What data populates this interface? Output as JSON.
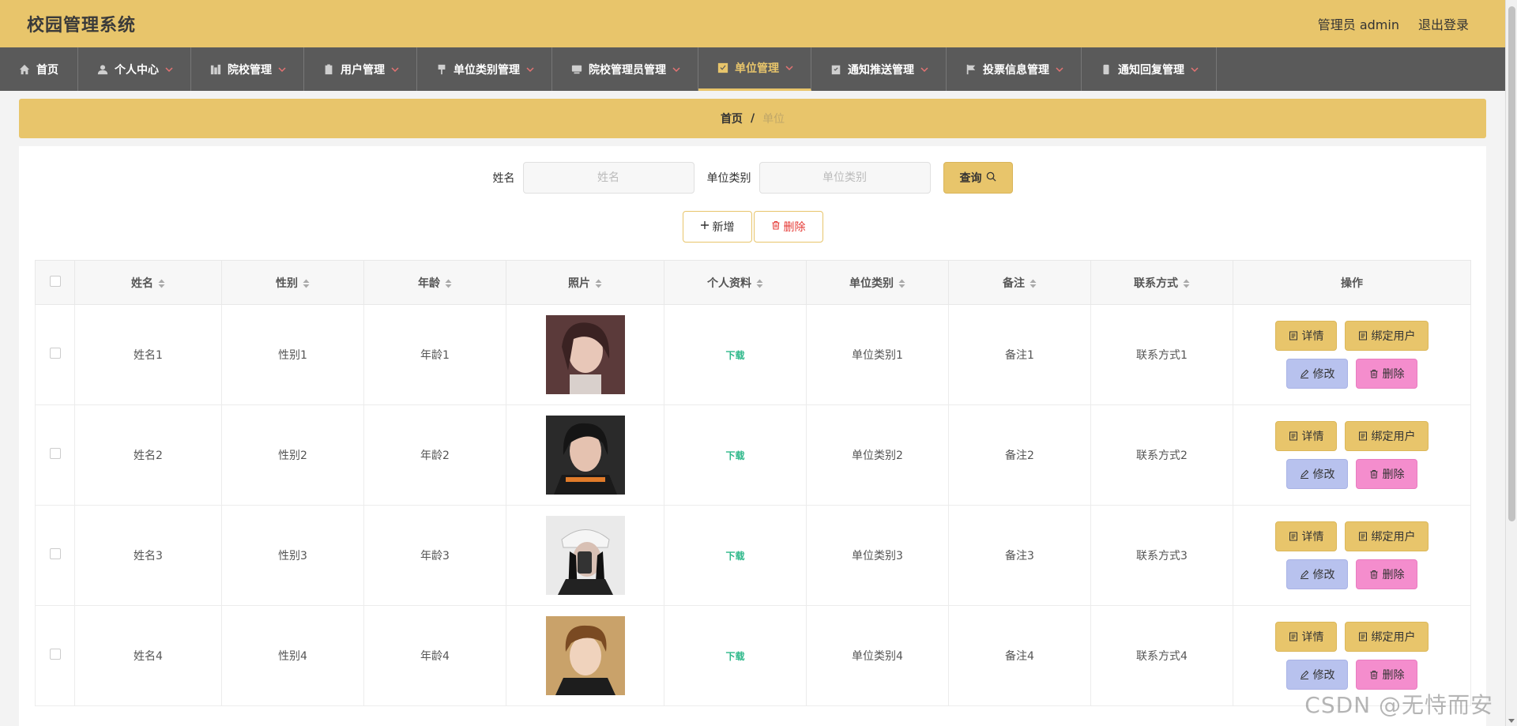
{
  "header": {
    "app_title": "校园管理系统",
    "user_label": "管理员 admin",
    "logout_label": "退出登录"
  },
  "nav": {
    "items": [
      {
        "label": "首页",
        "icon": "home-icon",
        "active": false
      },
      {
        "label": "个人中心",
        "icon": "user-icon",
        "active": false
      },
      {
        "label": "院校管理",
        "icon": "building-icon",
        "active": false
      },
      {
        "label": "用户管理",
        "icon": "clipboard-icon",
        "active": false
      },
      {
        "label": "单位类别管理",
        "icon": "flag-icon",
        "active": false
      },
      {
        "label": "院校管理员管理",
        "icon": "monitor-icon",
        "active": false
      },
      {
        "label": "单位管理",
        "icon": "check-square-icon",
        "active": true
      },
      {
        "label": "通知推送管理",
        "icon": "clipboard-check-icon",
        "active": false
      },
      {
        "label": "投票信息管理",
        "icon": "flag-icon",
        "active": false
      },
      {
        "label": "通知回复管理",
        "icon": "phone-icon",
        "active": false
      }
    ]
  },
  "breadcrumb": {
    "home": "首页",
    "separator": "/",
    "current": "单位"
  },
  "search": {
    "name_label": "姓名",
    "name_placeholder": "姓名",
    "category_label": "单位类别",
    "category_placeholder": "单位类别",
    "query_label": "查询"
  },
  "actions": {
    "add_label": "新增",
    "delete_label": "删除"
  },
  "table": {
    "columns": [
      "姓名",
      "性别",
      "年龄",
      "照片",
      "个人资料",
      "单位类别",
      "备注",
      "联系方式",
      "操作"
    ],
    "rows": [
      {
        "name": "姓名1",
        "gender": "性别1",
        "age": "年龄1",
        "profile": "下载",
        "category": "单位类别1",
        "remark": "备注1",
        "contact": "联系方式1"
      },
      {
        "name": "姓名2",
        "gender": "性别2",
        "age": "年龄2",
        "profile": "下载",
        "category": "单位类别2",
        "remark": "备注2",
        "contact": "联系方式2"
      },
      {
        "name": "姓名3",
        "gender": "性别3",
        "age": "年龄3",
        "profile": "下载",
        "category": "单位类别3",
        "remark": "备注3",
        "contact": "联系方式3"
      },
      {
        "name": "姓名4",
        "gender": "性别4",
        "age": "年龄4",
        "profile": "下载",
        "category": "单位类别4",
        "remark": "备注4",
        "contact": "联系方式4"
      }
    ],
    "ops": {
      "detail": "详情",
      "bind": "绑定用户",
      "edit": "修改",
      "delete": "删除"
    }
  },
  "watermark": "CSDN @无恃而安",
  "colors": {
    "accent": "#e8c56b",
    "nav_bg": "#5a5a5a",
    "edit_btn": "#b8c2ee",
    "delete_btn": "#f48dcd",
    "download_link": "#2eb88a"
  }
}
